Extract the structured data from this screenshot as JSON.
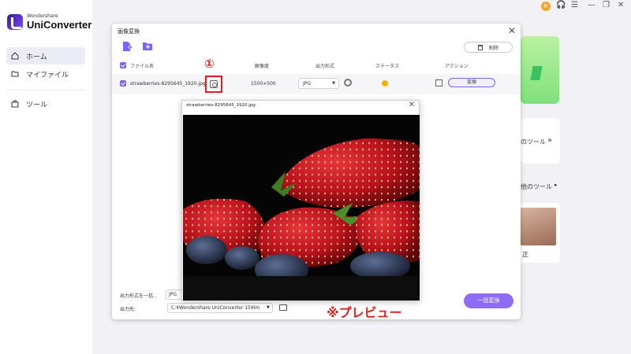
{
  "app": {
    "brand": "Wondershare",
    "name": "UniConverter"
  },
  "sidebar": {
    "items": [
      {
        "label": "ホーム",
        "icon": "home-icon",
        "active": true
      },
      {
        "label": "マイファイル",
        "icon": "folder-icon"
      },
      {
        "label": "ツール",
        "icon": "toolbox-icon"
      }
    ]
  },
  "topbar": {
    "avatar_letter": "R"
  },
  "background": {
    "tools_text": "のツール",
    "tools_text2": "他のツール",
    "photo_caption": "正"
  },
  "dialog": {
    "title": "画像変換",
    "delete_label": "削除",
    "columns": {
      "filename": "ファイル名",
      "resolution": "解像度",
      "output_format": "出力形式",
      "status": "ステータス",
      "action": "アクション"
    },
    "row": {
      "filename": "strawberries-8295645_1920.jpg",
      "resolution": "1500×500",
      "format": "JPG",
      "convert_label": "変換"
    },
    "footer": {
      "format_all_label": "出力形式を一括...",
      "format_all_value": "JPG",
      "output_label": "出力先:",
      "output_path": "C:¥Wondershare UniConverter 15¥Im",
      "batch_convert_label": "一括変換"
    }
  },
  "preview": {
    "title": "strawberries-8295645_1920.jpg"
  },
  "annotations": {
    "marker": "①",
    "caption": "※プレビュー"
  },
  "colors": {
    "accent": "#7b61ff",
    "annotation": "#e02020",
    "status": "#f5b000"
  }
}
